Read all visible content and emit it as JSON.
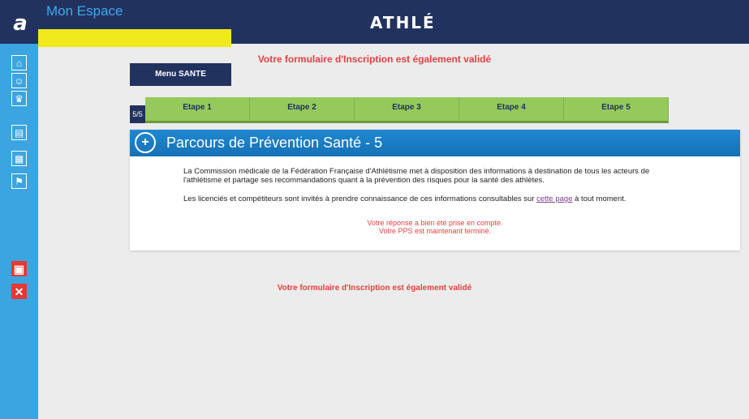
{
  "header": {
    "logo_letter": "a",
    "space_title": "Mon Espace",
    "brand": "ATHLÉ"
  },
  "sidebar": {
    "items": [
      {
        "icon": "home-icon",
        "glyph": "⌂"
      },
      {
        "icon": "user-icon",
        "glyph": "☺"
      },
      {
        "icon": "trophy-icon",
        "glyph": "♛"
      },
      {
        "icon": "id-card-icon",
        "glyph": "▤"
      },
      {
        "icon": "calendar-icon",
        "glyph": "▦"
      },
      {
        "icon": "runner-icon",
        "glyph": "⚑"
      }
    ],
    "bottom_items": [
      {
        "icon": "devices-icon",
        "glyph": "▣"
      },
      {
        "icon": "close-icon",
        "glyph": "✕"
      }
    ]
  },
  "top_message": "Votre formulaire d'Inscription est également validé",
  "menu_button": "Menu SANTE",
  "steps": {
    "count": "5/5",
    "items": [
      "Etape 1",
      "Etape 2",
      "Etape 3",
      "Etape 4",
      "Etape 5"
    ]
  },
  "panel": {
    "title": "Parcours de Prévention Santé - 5",
    "paragraph1": "La Commission médicale de la Fédération Française d'Athlétisme met à disposition des informations à destination de tous les acteurs de l'athlétisme et partage ses recommandations quant à la prévention des risques pour la santé des athlètes.",
    "paragraph2_before": "Les licenciés et compétiteurs sont invités à prendre connaissance de ces informations consultables sur ",
    "paragraph2_link": "cette page",
    "paragraph2_after": " à tout moment.",
    "status_line1": "Votre réponse a bien été prise en compte.",
    "status_line2": "Votre PPS est maintenant terminé."
  },
  "bottom_message": "Votre formulaire d'Inscription est également validé",
  "colors": {
    "navy": "#22325f",
    "sidebar_blue": "#3aa5e0",
    "step_green": "#95c95b",
    "alert_red": "#e84040",
    "highlight_yellow": "#f0e91b"
  }
}
